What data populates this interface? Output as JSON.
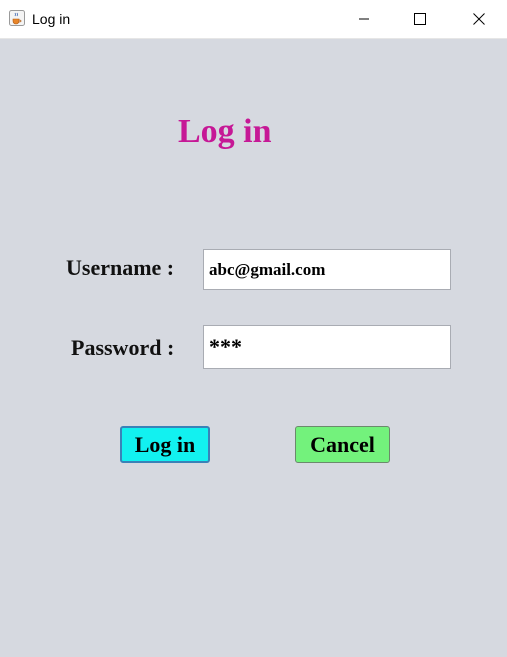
{
  "window": {
    "title": "Log in"
  },
  "form": {
    "heading": "Log in",
    "username_label": "Username :",
    "username_value": "abc@gmail.com",
    "password_label": "Password :",
    "password_masked": "***"
  },
  "buttons": {
    "login_label": "Log in",
    "cancel_label": "Cancel"
  },
  "colors": {
    "heading": "#c61896",
    "background": "#d6d9e0",
    "login_button": "#12f1f0",
    "cancel_button": "#73f27c"
  },
  "icons": {
    "app": "java-coffee-cup-icon",
    "minimize": "minimize-icon",
    "maximize": "maximize-icon",
    "close": "close-icon"
  }
}
